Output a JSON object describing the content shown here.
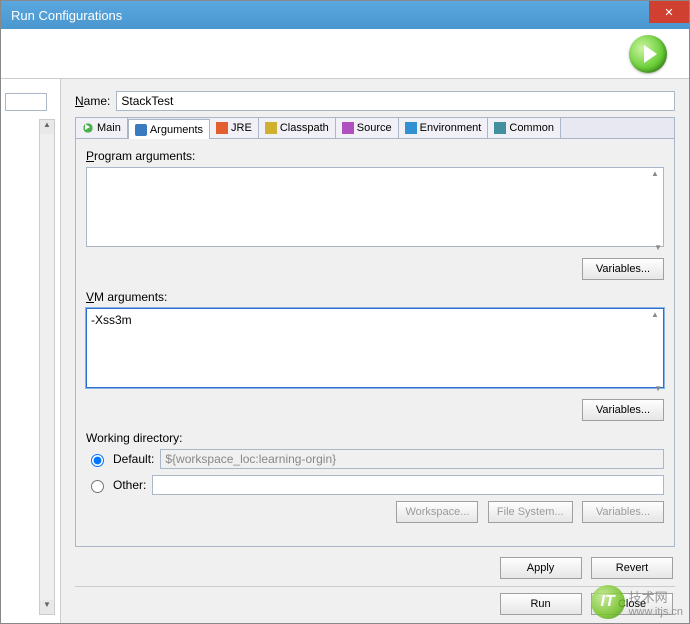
{
  "window": {
    "title": "Run Configurations"
  },
  "name_field": {
    "label_pre": "N",
    "label_rest": "ame:",
    "value": "StackTest"
  },
  "tabs": {
    "main": "Main",
    "arguments": "Arguments",
    "jre": "JRE",
    "classpath": "Classpath",
    "source": "Source",
    "environment": "Environment",
    "common": "Common"
  },
  "program_args": {
    "label_pre": "P",
    "label_rest": "rogram arguments:",
    "value": "",
    "variables_btn": "Variables..."
  },
  "vm_args": {
    "label_pre": "V",
    "label_rest": "M arguments:",
    "value": "-Xss3m",
    "variables_btn": "Variables..."
  },
  "working_dir": {
    "label": "Working directory:",
    "default_label_pre": "D",
    "default_label_rest": "efault:",
    "default_value": "${workspace_loc:learning-orgin}",
    "other_label_pre": "O",
    "other_label_rest": "ther:",
    "other_value": "",
    "workspace_btn": "Workspace...",
    "filesystem_btn": "File System...",
    "variables_btn": "Variables..."
  },
  "actions": {
    "apply": "Apply",
    "revert": "Revert",
    "run": "Run",
    "close": "Close"
  },
  "watermark": {
    "logo_text": "IT",
    "text": "技术网",
    "url": "www.itjs.cn"
  }
}
